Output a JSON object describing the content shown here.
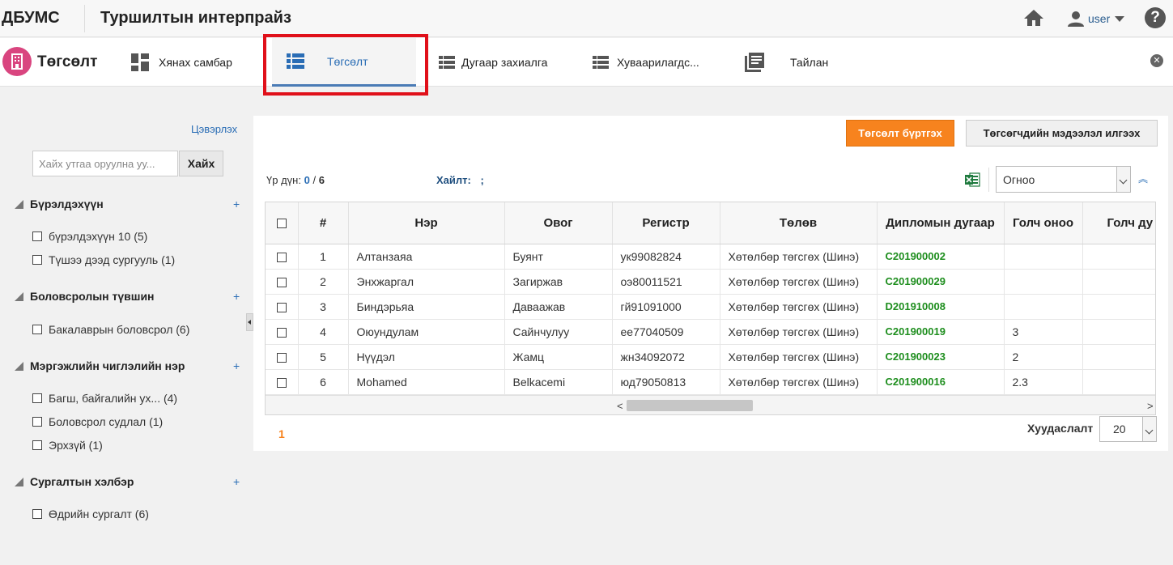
{
  "header": {
    "logo": "ДБУМС",
    "org_title": "Туршилтын интерпрайз",
    "user_name": "user",
    "help_symbol": "?"
  },
  "nav": {
    "module_title": "Төгсөлт",
    "items": [
      {
        "label": "Хянах самбар",
        "icon": "dashboard-icon",
        "active": false
      },
      {
        "label": "Төгсөлт",
        "icon": "list-icon",
        "active": true
      },
      {
        "label": "Дугаар захиалга",
        "icon": "list-icon",
        "active": false
      },
      {
        "label": "Хуваарилагдс...",
        "icon": "list-icon",
        "active": false
      },
      {
        "label": "Тайлан",
        "icon": "report-icon",
        "active": false
      }
    ],
    "close_symbol": "✕"
  },
  "sidebar": {
    "clear_label": "Цэвэрлэх",
    "search_placeholder": "Хайх утгаа оруулна уу...",
    "search_button": "Хайх",
    "plus": "+",
    "groups": [
      {
        "title": "Бүрэлдэхүүн",
        "items": [
          "бүрэлдэхүүн 10 (5)",
          "Түшээ дээд сургууль (1)"
        ]
      },
      {
        "title": "Боловсролын түвшин",
        "items": [
          "Бакалаврын боловсрол (6)"
        ]
      },
      {
        "title": "Мэргэжлийн чиглэлийн нэр",
        "items": [
          "Багш, байгалийн ух... (4)",
          "Боловсрол судлал (1)",
          "Эрхзүй (1)"
        ]
      },
      {
        "title": "Сургалтын хэлбэр",
        "items": [
          "Өдрийн сургалт (6)"
        ]
      }
    ]
  },
  "toolbar": {
    "register_button": "Төгсөлт бүртгэх",
    "send_info_button": "Төгсөгчдийн мэдээлэл илгээх",
    "result_label": "Үр дүн:",
    "result_selected": "0",
    "result_separator": "/",
    "result_total": "6",
    "search_label": "Хайлт:",
    "search_value": ";",
    "sort_value": "Огноо",
    "sort_direction_symbol": "︽",
    "excel_icon": "excel-icon"
  },
  "table": {
    "headers": [
      "#",
      "Нэр",
      "Овог",
      "Регистр",
      "Төлөв",
      "Дипломын дугаар",
      "Голч оноо",
      "Голч ду"
    ],
    "rows": [
      {
        "num": "1",
        "name": "Алтанзаяа",
        "surname": "Буянт",
        "register": "ук99082824",
        "status": "Хөтөлбөр төгсгөх (Шинэ)",
        "diploma": "C201900002",
        "gpa": ""
      },
      {
        "num": "2",
        "name": "Энхжаргал",
        "surname": "Загиржав",
        "register": "оэ80011521",
        "status": "Хөтөлбөр төгсгөх (Шинэ)",
        "diploma": "C201900029",
        "gpa": ""
      },
      {
        "num": "3",
        "name": "Биндэрьяа",
        "surname": "Даваажав",
        "register": "гй91091000",
        "status": "Хөтөлбөр төгсгөх (Шинэ)",
        "diploma": "D201910008",
        "gpa": ""
      },
      {
        "num": "4",
        "name": "Оюундулам",
        "surname": "Сайнчулуу",
        "register": "ее77040509",
        "status": "Хөтөлбөр төгсгөх (Шинэ)",
        "diploma": "C201900019",
        "gpa": "3"
      },
      {
        "num": "5",
        "name": "Нүүдэл",
        "surname": "Жамц",
        "register": "жн34092072",
        "status": "Хөтөлбөр төгсгөх (Шинэ)",
        "diploma": "C201900023",
        "gpa": "2"
      },
      {
        "num": "6",
        "name": "Mohamed",
        "surname": "Belkacemi",
        "register": "юд79050813",
        "status": "Хөтөлбөр төгсгөх (Шинэ)",
        "diploma": "C201900016",
        "gpa": "2.3"
      }
    ]
  },
  "pagination": {
    "current_page": "1",
    "page_size_label": "Хуудаслалт",
    "page_size": "20"
  },
  "colors": {
    "accent_orange": "#f7831e",
    "link_blue": "#2a6db5",
    "diploma_green": "#1e8e1e",
    "highlight_red": "#e0101a",
    "module_pink": "#d9457f"
  }
}
